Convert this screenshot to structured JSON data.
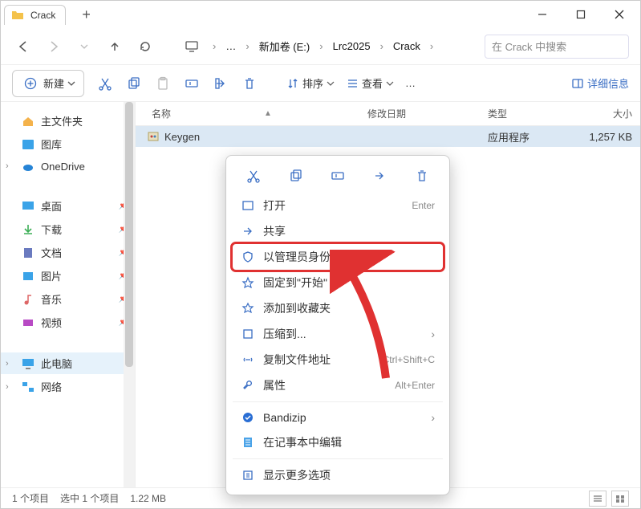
{
  "title": {
    "tab": "Crack"
  },
  "nav": {
    "drive": "新加卷 (E:)",
    "folder1": "Lrc2025",
    "folder2": "Crack",
    "search_placeholder": "在 Crack 中搜索",
    "dots": "…"
  },
  "toolbar": {
    "new": "新建",
    "sort": "排序",
    "view": "查看",
    "dots": "…",
    "details": "详细信息"
  },
  "columns": {
    "name": "名称",
    "date": "修改日期",
    "type": "类型",
    "size": "大小"
  },
  "files": [
    {
      "name": "Keygen",
      "date": "",
      "type": "应用程序",
      "size": "1,257 KB"
    }
  ],
  "sidebar": {
    "home": "主文件夹",
    "gallery": "图库",
    "onedrive": "OneDrive",
    "desktop": "桌面",
    "downloads": "下载",
    "documents": "文档",
    "pictures": "图片",
    "music": "音乐",
    "videos": "视频",
    "thispc": "此电脑",
    "network": "网络"
  },
  "context": {
    "open": "打开",
    "open_sc": "Enter",
    "share": "共享",
    "runadmin": "以管理员身份运行",
    "pin": "固定到\"开始\"",
    "fav": "添加到收藏夹",
    "compress": "压缩到...",
    "copypath": "复制文件地址",
    "copypath_sc": "Ctrl+Shift+C",
    "props": "属性",
    "props_sc": "Alt+Enter",
    "bandizip": "Bandizip",
    "notepad": "在记事本中编辑",
    "more": "显示更多选项"
  },
  "status": {
    "count": "1 个项目",
    "selected": "选中 1 个项目",
    "size": "1.22 MB"
  }
}
